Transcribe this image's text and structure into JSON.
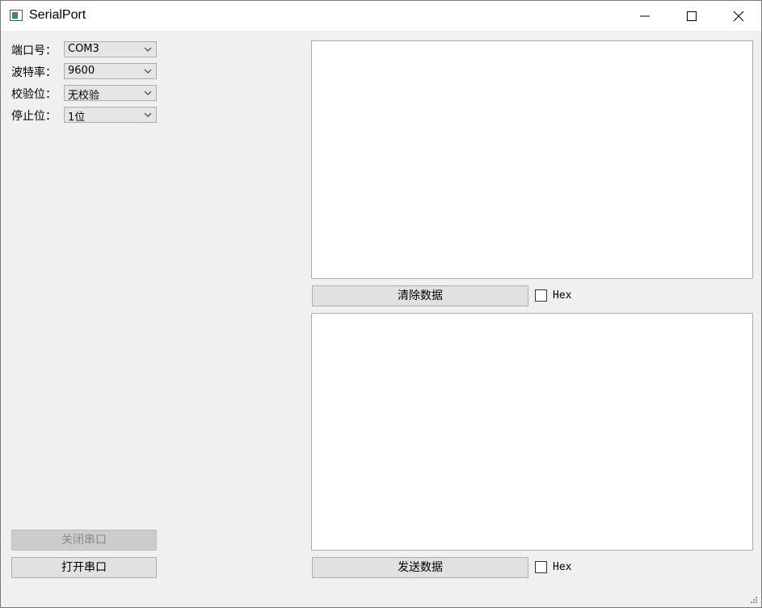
{
  "window": {
    "title": "SerialPort"
  },
  "settings": {
    "port_label": "端口号：",
    "port_value": "COM3",
    "baud_label": "波特率：",
    "baud_value": "9600",
    "parity_label": "校验位：",
    "parity_value": "无校验",
    "stop_label": "停止位：",
    "stop_value": "1位"
  },
  "receive": {
    "clear_label": "清除数据",
    "hex_label": "Hex",
    "hex_checked": false
  },
  "send": {
    "send_label": "发送数据",
    "hex_label": "Hex",
    "hex_checked": false
  },
  "port_buttons": {
    "close_label": "关闭串口",
    "open_label": "打开串口"
  },
  "icons": {
    "app": "window-icon",
    "minimize": "minimize-icon",
    "maximize": "maximize-icon",
    "close": "close-icon"
  }
}
